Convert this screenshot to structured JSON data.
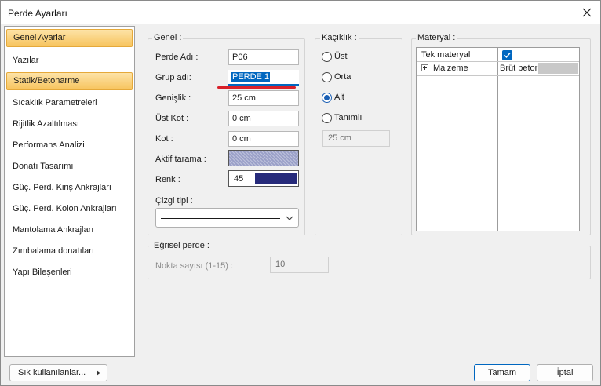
{
  "window": {
    "title": "Perde Ayarları"
  },
  "sidebar": {
    "items": [
      {
        "label": "Genel Ayarlar",
        "kind": "header"
      },
      {
        "label": "Yazılar",
        "kind": "item"
      },
      {
        "label": "Statik/Betonarme",
        "kind": "header"
      },
      {
        "label": "Sıcaklık Parametreleri",
        "kind": "item"
      },
      {
        "label": "Rijitlik Azaltılması",
        "kind": "item"
      },
      {
        "label": "Performans Analizi",
        "kind": "item"
      },
      {
        "label": "Donatı Tasarımı",
        "kind": "item"
      },
      {
        "label": "Güç. Perd. Kiriş Ankrajları",
        "kind": "item"
      },
      {
        "label": "Güç. Perd. Kolon Ankrajları",
        "kind": "item"
      },
      {
        "label": "Mantolama Ankrajları",
        "kind": "item"
      },
      {
        "label": "Zımbalama donatıları",
        "kind": "item"
      },
      {
        "label": "Yapı Bileşenleri",
        "kind": "item"
      }
    ]
  },
  "genel": {
    "legend": "Genel :",
    "perde_adi_label": "Perde Adı :",
    "perde_adi_value": "P06",
    "grup_adi_label": "Grup adı:",
    "grup_adi_value": "PERDE 1",
    "genislik_label": "Genişlik :",
    "genislik_value": "25 cm",
    "ust_kot_label": "Üst Kot :",
    "ust_kot_value": "0 cm",
    "kot_label": "Kot :",
    "kot_value": "0 cm",
    "aktif_tarama_label": "Aktif tarama :",
    "renk_label": "Renk :",
    "renk_value": "45",
    "renk_color": "#262a7a",
    "cizgi_tipi_label": "Çizgi tipi :"
  },
  "kaciklik": {
    "legend": "Kaçıklık :",
    "options": [
      {
        "label": "Üst",
        "checked": false
      },
      {
        "label": "Orta",
        "checked": false
      },
      {
        "label": "Alt",
        "checked": true
      },
      {
        "label": "Tanımlı",
        "checked": false
      }
    ],
    "value": "25 cm"
  },
  "materyal": {
    "legend": "Materyal :",
    "tek_materyal_label": "Tek materyal",
    "tek_materyal_checked": true,
    "malzeme_label": "Malzeme",
    "malzeme_value": "Brüt betor"
  },
  "egrisel": {
    "legend": "Eğrisel perde :",
    "nokta_label": "Nokta sayısı (1-15) :",
    "nokta_value": "10"
  },
  "footer": {
    "sik_label": "Sık kullanılanlar...",
    "tamam_label": "Tamam",
    "iptal_label": "İptal"
  },
  "colors": {
    "accent": "#0067c0",
    "header_gradient_top": "#fde3a7",
    "header_gradient_bottom": "#f7c45e",
    "underline_red": "#d8202a"
  }
}
